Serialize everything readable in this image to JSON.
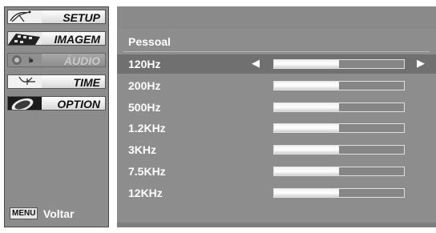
{
  "sidebar": {
    "items": [
      {
        "label": "SETUP",
        "state": "normal",
        "icon": "satellite-dish-icon"
      },
      {
        "label": "IMAGEM",
        "state": "normal",
        "icon": "film-strip-icon"
      },
      {
        "label": "ÁUDIO",
        "state": "selected",
        "icon": "speaker-icon"
      },
      {
        "label": "TIME",
        "state": "normal",
        "icon": "clock-icon"
      },
      {
        "label": "OPTION",
        "state": "normal",
        "icon": "option-badge-icon"
      }
    ],
    "back_key": "MENU",
    "back_label": "Voltar"
  },
  "panel": {
    "title": "Pessoal",
    "bands": [
      {
        "label": "120Hz",
        "level": 0.5,
        "selected": true
      },
      {
        "label": "200Hz",
        "level": 0.5,
        "selected": false
      },
      {
        "label": "500Hz",
        "level": 0.5,
        "selected": false
      },
      {
        "label": "1.2KHz",
        "level": 0.5,
        "selected": false
      },
      {
        "label": "3KHz",
        "level": 0.5,
        "selected": false
      },
      {
        "label": "7.5KHz",
        "level": 0.5,
        "selected": false
      },
      {
        "label": "12KHz",
        "level": 0.5,
        "selected": false
      }
    ],
    "arrow_left": "◀",
    "arrow_right": "▶"
  },
  "colors": {
    "panel_bg": "#8d8d8d",
    "selected_row": "#707070",
    "text": "#ffffff"
  }
}
